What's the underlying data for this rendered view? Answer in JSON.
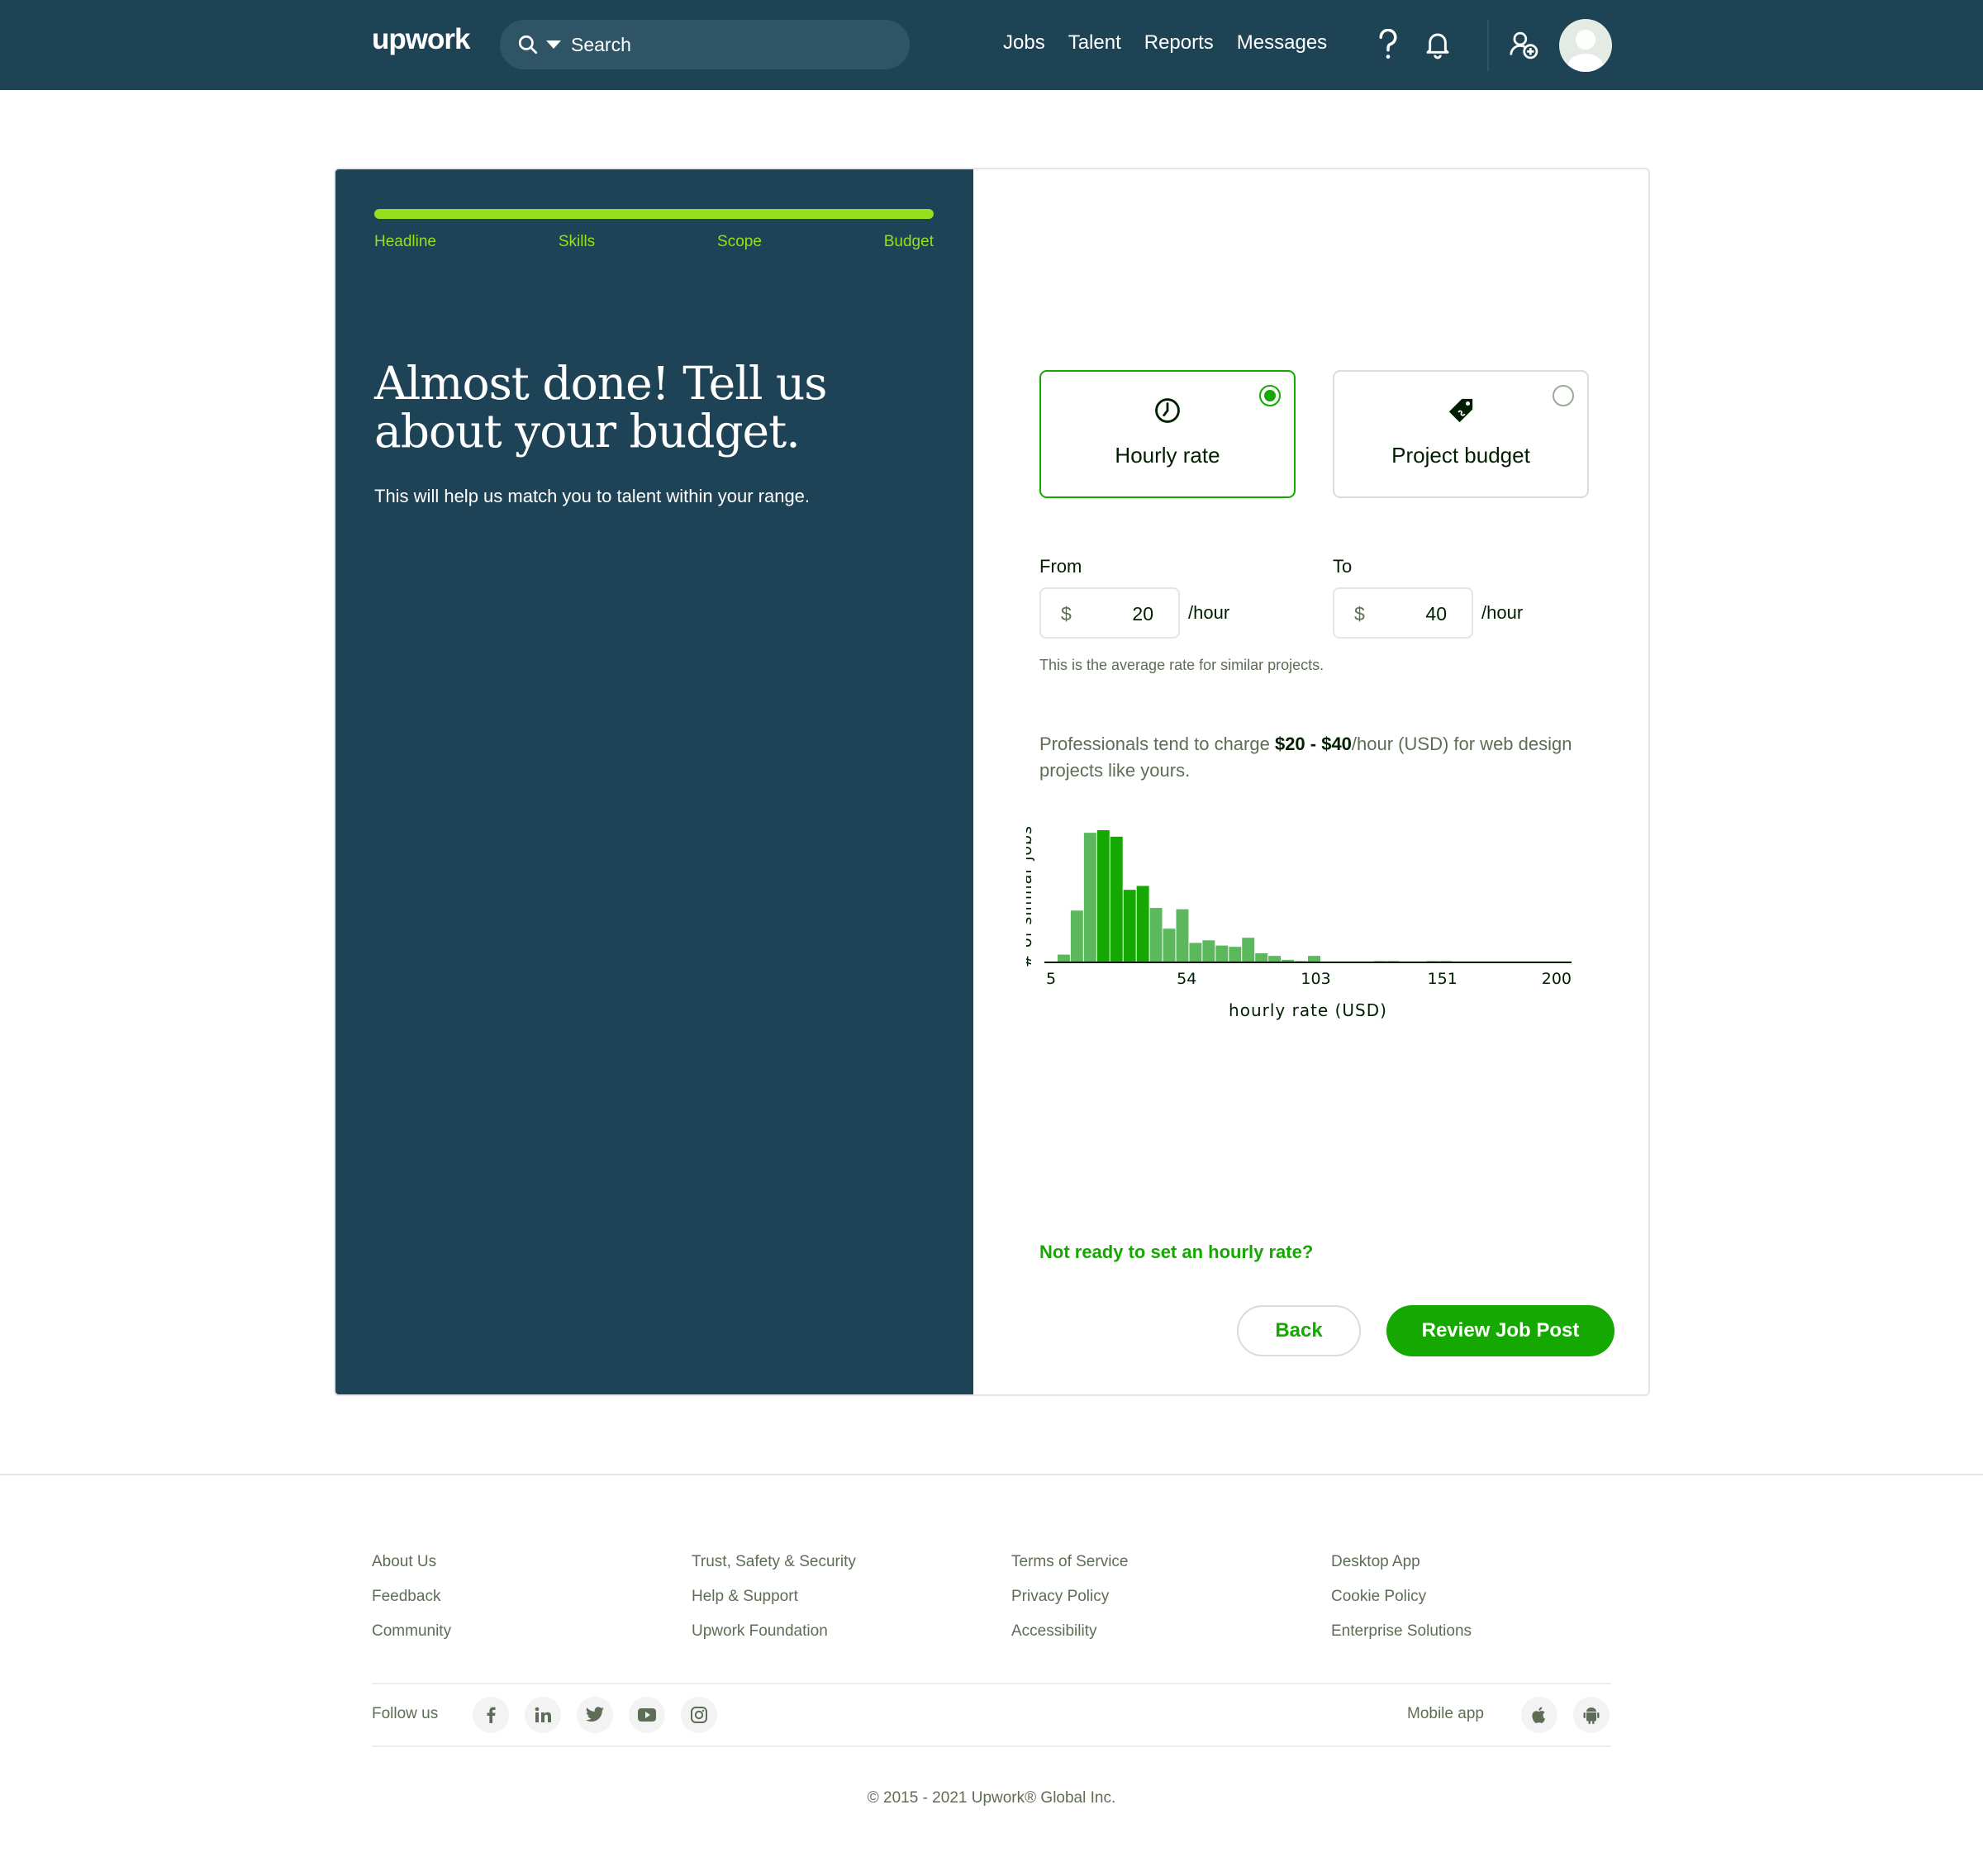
{
  "header": {
    "logo": "upwork",
    "search_placeholder": "Search",
    "nav": [
      "Jobs",
      "Talent",
      "Reports",
      "Messages"
    ]
  },
  "steps": [
    "Headline",
    "Skills",
    "Scope",
    "Budget"
  ],
  "progress_fraction": 1.0,
  "left": {
    "headline": "Almost done! Tell us about your budget.",
    "subhead": "This will help us match you to talent within your range."
  },
  "options": {
    "hourly_label": "Hourly rate",
    "project_label": "Project budget",
    "selected": "hourly"
  },
  "rate": {
    "from_label": "From",
    "to_label": "To",
    "currency": "$",
    "from_value": "20",
    "to_value": "40",
    "unit": "/hour",
    "note": "This is the average rate for similar projects."
  },
  "advice": {
    "prefix": "Professionals tend to charge ",
    "range": "$20 - $40",
    "suffix": "/hour (USD) for web design projects like yours."
  },
  "chart_data": {
    "type": "bar",
    "xlabel": "hourly rate (USD)",
    "ylabel": "# of similar jobs",
    "xticks": [
      "5",
      "54",
      "103",
      "151",
      "200"
    ],
    "xlim": [
      0,
      200
    ],
    "bin_width": 5,
    "highlight_range": [
      20,
      40
    ],
    "x": [
      5,
      10,
      15,
      20,
      25,
      30,
      35,
      40,
      45,
      50,
      55,
      60,
      65,
      70,
      75,
      80,
      85,
      90,
      95,
      100,
      105,
      110,
      115,
      120,
      125,
      130,
      135,
      140,
      145,
      150,
      155,
      160,
      165,
      170,
      175,
      180,
      185,
      190,
      195
    ],
    "values": [
      6,
      40,
      100,
      102,
      97,
      56,
      59,
      42,
      26,
      41,
      15,
      17,
      13,
      12,
      19,
      7,
      5,
      2,
      1,
      5,
      0,
      0,
      0,
      0,
      1,
      1,
      0,
      0,
      1,
      1,
      0,
      0,
      0,
      0,
      0,
      0,
      0,
      0,
      0
    ],
    "colors": {
      "highlight": "#14a800",
      "other": "#5cb85c"
    }
  },
  "not_ready_link": "Not ready to set an hourly rate?",
  "buttons": {
    "back": "Back",
    "review": "Review Job Post"
  },
  "footer": {
    "col1": [
      "About Us",
      "Feedback",
      "Community"
    ],
    "col2": [
      "Trust, Safety & Security",
      "Help & Support",
      "Upwork Foundation"
    ],
    "col3": [
      "Terms of Service",
      "Privacy Policy",
      "Accessibility"
    ],
    "col4": [
      "Desktop App",
      "Cookie Policy",
      "Enterprise Solutions"
    ],
    "follow_us": "Follow us",
    "social_icons": [
      "facebook-icon",
      "linkedin-icon",
      "twitter-icon",
      "youtube-icon",
      "instagram-icon"
    ],
    "mobile_app": "Mobile app",
    "copyright": "© 2015 - 2021 Upwork® Global Inc."
  },
  "colors": {
    "header": "#1d4354",
    "panel": "#1f4356",
    "accent": "#14a800",
    "lime": "#95e01c"
  }
}
